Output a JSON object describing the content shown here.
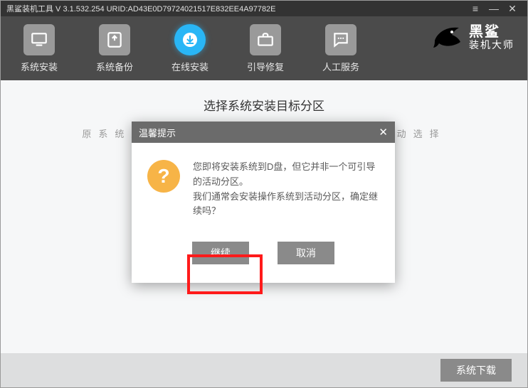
{
  "titlebar": {
    "text": "黑鲨装机工具 V 3.1.532.254 URID:AD43E0D79724021517E832EE4A97782E"
  },
  "nav": {
    "items": [
      {
        "key": "sys-install",
        "label": "系统安装"
      },
      {
        "key": "sys-backup",
        "label": "系统备份"
      },
      {
        "key": "online-install",
        "label": "在线安装"
      },
      {
        "key": "boot-repair",
        "label": "引导修复"
      },
      {
        "key": "manual-service",
        "label": "人工服务"
      }
    ]
  },
  "brand": {
    "line1": "黑鲨",
    "line2": "装机大师"
  },
  "main": {
    "page_title": "选择系统安装目标分区",
    "hint_prefix": "原系统盘",
    "hint_suffix": "手动选择"
  },
  "modal": {
    "title": "温馨提示",
    "msg_line1": "您即将安装系统到D盘，但它并非一个可引导的活动分区。",
    "msg_line2": "我们通常会安装操作系统到活动分区，确定继续吗？",
    "continue_label": "继续",
    "cancel_label": "取消"
  },
  "bottom": {
    "download_label": "系统下载"
  }
}
